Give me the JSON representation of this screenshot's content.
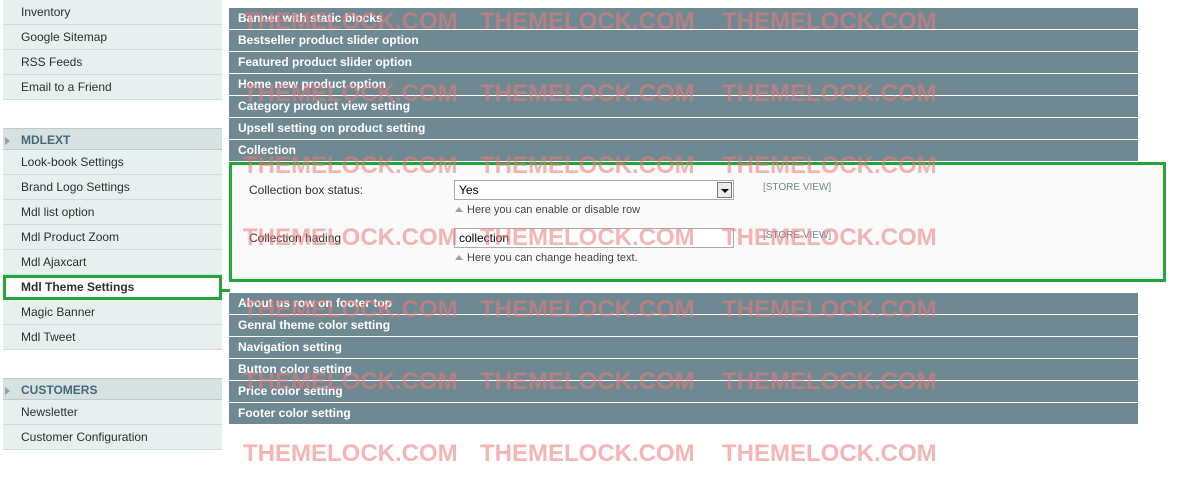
{
  "sidebar": {
    "top_items": [
      "Inventory",
      "Google Sitemap",
      "RSS Feeds",
      "Email to a Friend"
    ],
    "groups": [
      {
        "header": "MDLEXT",
        "items": [
          "Look-book Settings",
          "Brand Logo Settings",
          "Mdl list option",
          "Mdl Product Zoom",
          "Mdl Ajaxcart",
          "Mdl Theme Settings",
          "Magic Banner",
          "Mdl Tweet"
        ],
        "active_item": "Mdl Theme Settings"
      },
      {
        "header": "CUSTOMERS",
        "items": [
          "Newsletter",
          "Customer Configuration"
        ]
      }
    ]
  },
  "main": {
    "sections_before": [
      "Banner with static blocks",
      "Bestseller product slider option",
      "Featured product slider option",
      "Home new product option",
      "Category product view setting",
      "Upsell setting on product setting",
      "Collection"
    ],
    "collection_fields": {
      "box_status": {
        "label": "Collection box status:",
        "value": "Yes",
        "scope": "[STORE VIEW]",
        "note": "Here you can enable or disable row"
      },
      "heading": {
        "label": "Collection hading",
        "value": "collection",
        "scope": "[STORE VIEW]",
        "note": "Here you can change heading text."
      }
    },
    "sections_after": [
      "About us row on footer top",
      "Genral theme color setting",
      "Navigation setting",
      "Button color setting",
      "Price color setting",
      "Footer color setting"
    ]
  },
  "watermark": "THEMELOCK.COM",
  "colors": {
    "section_bar": "#6f8992",
    "highlight": "#22a63a",
    "sidebar_bg": "#e7efef",
    "watermark": "#ec7878"
  }
}
